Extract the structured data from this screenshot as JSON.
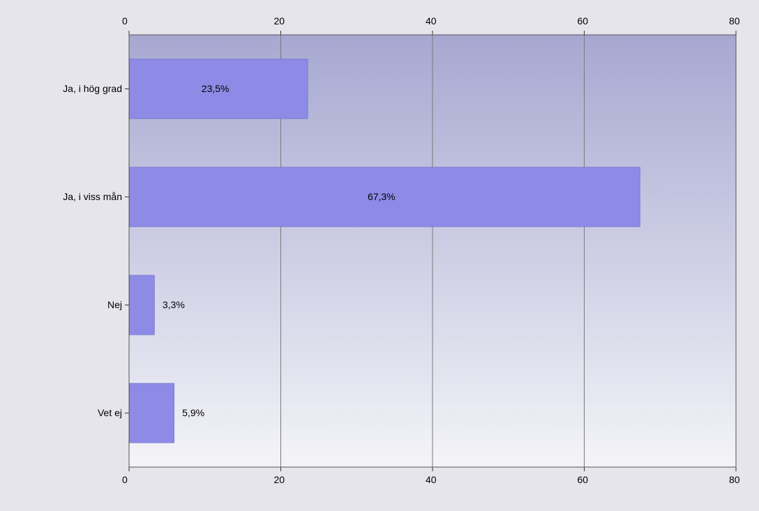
{
  "chart_data": {
    "type": "bar",
    "orientation": "horizontal",
    "categories": [
      "Ja, i hög grad",
      "Ja, i viss mån",
      "Nej",
      "Vet ej"
    ],
    "values": [
      23.5,
      67.3,
      3.3,
      5.9
    ],
    "value_labels": [
      "23,5%",
      "67,3%",
      "3,3%",
      "5,9%"
    ],
    "xlim": [
      0,
      80
    ],
    "x_ticks": [
      0,
      20,
      40,
      60,
      80
    ],
    "x_tick_labels_top": [
      "0",
      "20",
      "40",
      "60",
      "80"
    ],
    "x_tick_labels_bottom": [
      "0",
      "20",
      "40",
      "60",
      "80"
    ],
    "bar_color": "#8d8be6",
    "plot_bg_from": "#a6a8d1",
    "plot_bg_to": "#f4f4f8"
  }
}
